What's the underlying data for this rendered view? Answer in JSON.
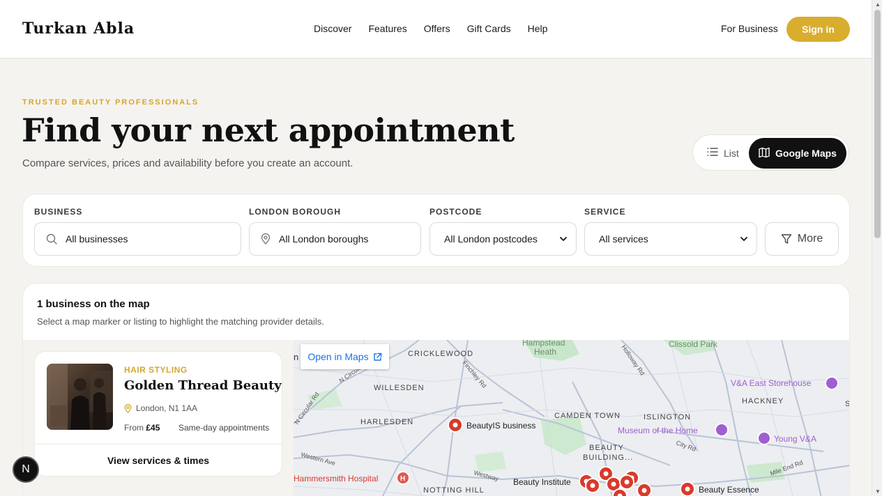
{
  "header": {
    "logo": "Turkan Abla",
    "nav": [
      "Discover",
      "Features",
      "Offers",
      "Gift Cards",
      "Help"
    ],
    "for_business": "For Business",
    "sign_in": "Sign in"
  },
  "hero": {
    "eyebrow": "TRUSTED BEAUTY PROFESSIONALS",
    "title": "Find your next appointment",
    "subtitle": "Compare services, prices and availability before you create an account."
  },
  "view_toggle": {
    "list_label": "List",
    "maps_label": "Google Maps",
    "active": "Google Maps"
  },
  "filters": {
    "business": {
      "label": "BUSINESS",
      "value": "All businesses"
    },
    "borough": {
      "label": "LONDON BOROUGH",
      "value": "All London boroughs"
    },
    "postcode": {
      "label": "POSTCODE",
      "value": "All London postcodes"
    },
    "service": {
      "label": "SERVICE",
      "value": "All services"
    },
    "more_label": "More"
  },
  "results": {
    "title": "1 business on the map",
    "subtitle": "Select a map marker or listing to highlight the matching provider details."
  },
  "business_card": {
    "category": "HAIR STYLING",
    "name": "Golden Thread Beauty",
    "location": "London, N1 1AA",
    "price_prefix": "From",
    "price": "£45",
    "availability": "Same-day appointments",
    "cta": "View services & times"
  },
  "map": {
    "open_in_maps": "Open in Maps",
    "partial_label": "n",
    "labels": {
      "cricklewood": "CRICKLEWOOD",
      "willesden": "WILLESDEN",
      "harlesden": "HARLESDEN",
      "camden_town": "CAMDEN TOWN",
      "islington": "ISLINGTON",
      "hackney": "HACKNEY",
      "notting_hill": "NOTTING HILL",
      "beauty_building_1": "BEAUTY",
      "beauty_building_2": "BUILDING...",
      "hampstead_heath_1": "Hampstead",
      "hampstead_heath_2": "Heath",
      "clissold_park": "Clissold Park",
      "va_east": "V&A East Storehouse",
      "museum_home": "Museum of the Home",
      "young_va": "Young V&A",
      "hammersmith": "Hammersmith Hospital",
      "beautyis": "BeautyIS business",
      "beauty_institute": "Beauty Institute",
      "beauty_essence": "Beauty Essence",
      "finchley_rd": "Finchley Rd",
      "holloway_rd": "Holloway Rd",
      "n_circular_rd_1": "N Circular",
      "n_circular_rd_2": "N Circular Rd",
      "western_ave": "Western Ave",
      "westway": "Westway",
      "city_rd": "City Rd",
      "mile_end_rd": "Mile End Rd",
      "hospital_marker": "H",
      "edge_s": "S"
    }
  },
  "next_badge": "N",
  "colors": {
    "accent_gold": "#d9ad2e",
    "dark": "#111111",
    "marker_red": "#d93a2b",
    "museum_purple": "#a05fd0",
    "link_blue": "#1a73e8"
  }
}
